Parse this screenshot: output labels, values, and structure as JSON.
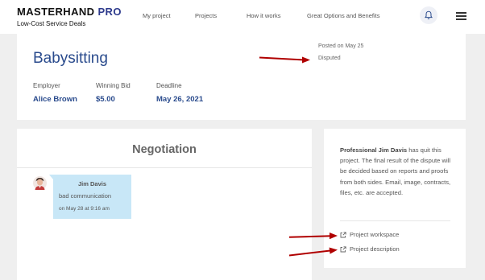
{
  "header": {
    "brand_main": "MASTERHAND",
    "brand_pro": "PRO",
    "tagline": "Low-Cost Service Deals",
    "nav": [
      "My project",
      "Projects",
      "How it works",
      "Great Options and Benefits"
    ],
    "bell_icon": "bell-icon",
    "menu_icon": "hamburger-icon"
  },
  "project": {
    "title": "Babysitting",
    "posted": "Posted on May 25",
    "status": "Disputed",
    "employer_label": "Employer",
    "employer_value": "Alice Brown",
    "bid_label": "Winning Bid",
    "bid_value": "$5.00",
    "deadline_label": "Deadline",
    "deadline_value": "May 26, 2021"
  },
  "negotiation": {
    "title": "Negotiation",
    "message": {
      "author": "Jim Davis",
      "text": "bad communication",
      "time": "on May 28 at 9:16 am"
    }
  },
  "sidebar": {
    "notice_bold": "Professional Jim Davis",
    "notice_rest": " has quit this project. The final result of the dispute will be decided based on reports and proofs from both sides. Email, image, contracts, files, etc. are accepted.",
    "links": [
      {
        "label": "Project workspace",
        "icon": "external-link-icon"
      },
      {
        "label": "Project description",
        "icon": "external-link-icon"
      }
    ]
  },
  "colors": {
    "brand_blue": "#2a4b8d",
    "bubble": "#c8e7f7",
    "annotation_red": "#b00000"
  }
}
